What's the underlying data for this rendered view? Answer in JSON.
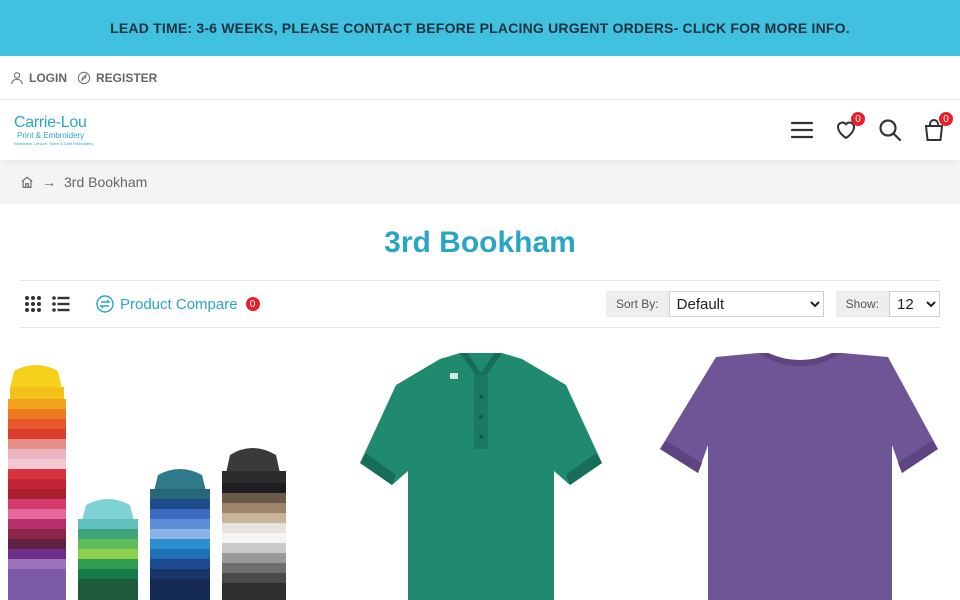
{
  "announcement": "LEAD TIME: 3-6 WEEKS, PLEASE CONTACT BEFORE PLACING URGENT ORDERS- CLICK FOR MORE INFO.",
  "topbar": {
    "login": "LOGIN",
    "register": "REGISTER"
  },
  "logo": {
    "line1": "Carrie-Lou",
    "line2": "Print & Embroidery",
    "line3": "Workwear, Leisure, Team & Club Embroidery"
  },
  "header": {
    "wishlist_count": "0",
    "cart_count": "0"
  },
  "breadcrumb": {
    "current": "3rd Bookham",
    "separator": "→"
  },
  "page_title": "3rd Bookham",
  "toolbar": {
    "compare_label": "Product Compare",
    "compare_count": "0",
    "sort_label": "Sort By:",
    "sort_value": "Default",
    "show_label": "Show:",
    "show_value": "12"
  },
  "colors": {
    "accent": "#2aa6c5",
    "banner": "#3fc1df",
    "badge": "#e8202a"
  },
  "icons": [
    "user-icon",
    "register-icon",
    "menu-icon",
    "heart-icon",
    "search-icon",
    "cart-icon",
    "home-icon",
    "grid-icon",
    "list-icon",
    "compare-icon"
  ]
}
